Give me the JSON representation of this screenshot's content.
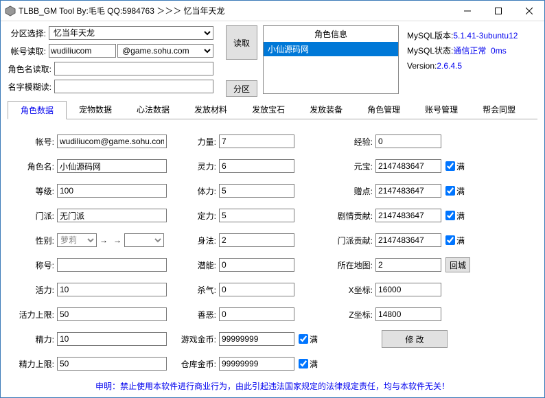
{
  "title": "TLBB_GM Tool By:毛毛 QQ:5984763 ＞＞＞ 忆当年天龙",
  "top": {
    "zoneLabel": "分区选择:",
    "zoneValue": "忆当年天龙",
    "accountLabel": "帐号读取:",
    "accountValue": "wudiliucom",
    "accountDomain": "@game.sohu.com",
    "charLabel": "角色名读取:",
    "charValue": "",
    "fuzzyLabel": "名字模糊读:",
    "fuzzyValue": "",
    "readBtn": "读取",
    "zoneBtn": "分区",
    "charInfoTitle": "角色信息",
    "charInfoItem": "小仙源码网"
  },
  "status": {
    "mysqlVersionLabel": "MySQL版本:",
    "mysqlVersionValue": "5.1.41-3ubuntu12",
    "mysqlStateLabel": "MySQL状态:",
    "mysqlStateValue": "通信正常",
    "mysqlStateMs": "0ms",
    "versionLabel": "Version:",
    "versionValue": "2.6.4.5"
  },
  "tabs": [
    "角色数据",
    "宠物数据",
    "心法数据",
    "发放材料",
    "发放宝石",
    "发放装备",
    "角色管理",
    "账号管理",
    "帮会同盟"
  ],
  "col1": {
    "account": {
      "label": "帐号:",
      "value": "wudiliucom@game.sohu.com"
    },
    "charName": {
      "label": "角色名:",
      "value": "小仙源码网"
    },
    "level": {
      "label": "等级:",
      "value": "100"
    },
    "menpai": {
      "label": "门派:",
      "value": "无门派"
    },
    "gender": {
      "label": "性别:",
      "value": "萝莉"
    },
    "title": {
      "label": "称号:",
      "value": ""
    },
    "vigor": {
      "label": "活力:",
      "value": "10"
    },
    "vigorMax": {
      "label": "活力上限:",
      "value": "50"
    },
    "energy": {
      "label": "精力:",
      "value": "10"
    },
    "energyMax": {
      "label": "精力上限:",
      "value": "50"
    }
  },
  "col2": {
    "str": {
      "label": "力量:",
      "value": "7"
    },
    "spi": {
      "label": "灵力:",
      "value": "6"
    },
    "con": {
      "label": "体力:",
      "value": "5"
    },
    "wil": {
      "label": "定力:",
      "value": "5"
    },
    "dex": {
      "label": "身法:",
      "value": "2"
    },
    "pot": {
      "label": "潜能:",
      "value": "0"
    },
    "kill": {
      "label": "杀气:",
      "value": "0"
    },
    "good": {
      "label": "善恶:",
      "value": "0"
    },
    "gameGold": {
      "label": "游戏金币:",
      "value": "99999999"
    },
    "bankGold": {
      "label": "仓库金币:",
      "value": "99999999"
    }
  },
  "col3": {
    "exp": {
      "label": "经验:",
      "value": "0"
    },
    "yuanbao": {
      "label": "元宝:",
      "value": "2147483647"
    },
    "gift": {
      "label": "赠点:",
      "value": "2147483647"
    },
    "juqing": {
      "label": "剧情贡献:",
      "value": "2147483647"
    },
    "mpgx": {
      "label": "门派贡献:",
      "value": "2147483647"
    },
    "map": {
      "label": "所在地图:",
      "value": "2"
    },
    "x": {
      "label": "X坐标:",
      "value": "16000"
    },
    "z": {
      "label": "Z坐标:",
      "value": "14800"
    }
  },
  "buttons": {
    "full": "满",
    "backCity": "回城",
    "modify": "修 改"
  },
  "footer": "申明：禁止使用本软件进行商业行为，由此引起违法国家规定的法律规定责任，均与本软件无关！"
}
